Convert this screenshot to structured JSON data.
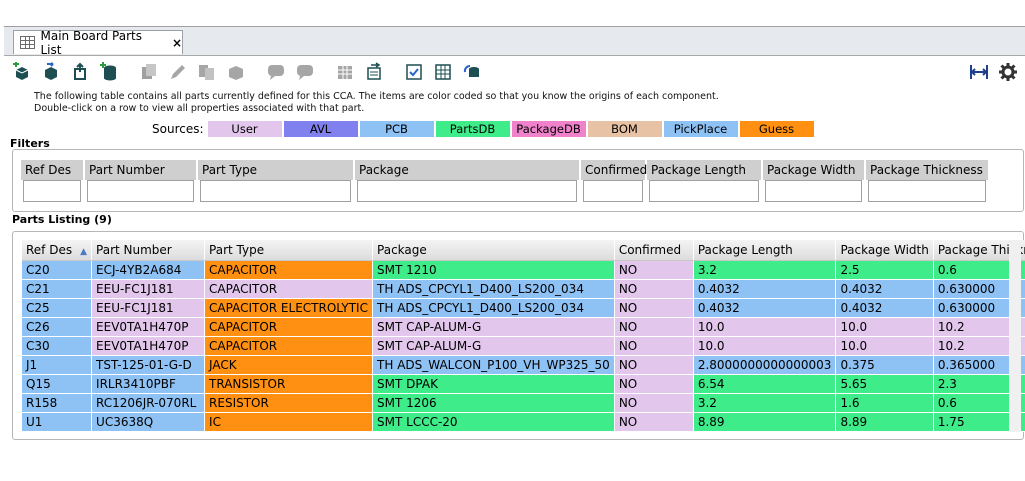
{
  "tab": {
    "title": "Main Board Parts List",
    "close": "×"
  },
  "toolbar": {
    "left_icons": [
      "add-part-icon",
      "import-icon",
      "export-icon",
      "add-database-icon",
      "copy-icon",
      "edit-icon",
      "duplicate-icon",
      "box-icon",
      "comment-icon",
      "comment-icon",
      "grid-import-icon",
      "grid-export-icon",
      "compare-icon",
      "table-icon",
      "sync-icon"
    ],
    "right_icons": [
      "fit-width-icon",
      "gear-icon"
    ]
  },
  "description": {
    "line1": "The following table contains all parts currently defined for this CCA. The items are color coded so that you know the origins of each component.",
    "line2": "Double-click on a row to view all properties associated with that part."
  },
  "sources": {
    "label": "Sources:",
    "items": [
      {
        "name": "User",
        "color": "#e2c6ec"
      },
      {
        "name": "AVL",
        "color": "#8080ef"
      },
      {
        "name": "PCB",
        "color": "#8ec1f4"
      },
      {
        "name": "PartsDB",
        "color": "#3fec8a"
      },
      {
        "name": "PackageDB",
        "color": "#f082cc"
      },
      {
        "name": "BOM",
        "color": "#e8c2a4"
      },
      {
        "name": "PickPlace",
        "color": "#8ec1f4"
      },
      {
        "name": "Guess",
        "color": "#ff9012"
      }
    ]
  },
  "filters": {
    "title": "Filters",
    "columns": [
      "Ref Des",
      "Part Number",
      "Part Type",
      "Package",
      "Confirmed",
      "Package Length",
      "Package Width",
      "Package Thickness"
    ]
  },
  "listing": {
    "title": "Parts Listing (9)",
    "sort_indicator": "▲",
    "columns": [
      "Ref Des",
      "Part Number",
      "Part Type",
      "Package",
      "Confirmed",
      "Package Length",
      "Package Width",
      "Package Thickness"
    ],
    "rows": [
      {
        "cells": [
          "C20",
          "ECJ-4YB2A684",
          "CAPACITOR",
          "SMT 1210",
          "NO",
          "3.2",
          "2.5",
          "0.6"
        ],
        "colors": [
          "#8ec1f4",
          "#8ec1f4",
          "#ff9012",
          "#3fec8a",
          "#e2c6ec",
          "#3fec8a",
          "#3fec8a",
          "#3fec8a"
        ]
      },
      {
        "cells": [
          "C21",
          "EEU-FC1J181",
          "CAPACITOR",
          "TH ADS_CPCYL1_D400_LS200_034",
          "NO",
          "0.4032",
          "0.4032",
          "0.630000"
        ],
        "colors": [
          "#8ec1f4",
          "#e2c6ec",
          "#e2c6ec",
          "#8ec1f4",
          "#e2c6ec",
          "#8ec1f4",
          "#8ec1f4",
          "#8ec1f4"
        ]
      },
      {
        "cells": [
          "C25",
          "EEU-FC1J181",
          "CAPACITOR ELECTROLYTIC",
          "TH ADS_CPCYL1_D400_LS200_034",
          "NO",
          "0.4032",
          "0.4032",
          "0.630000"
        ],
        "colors": [
          "#8ec1f4",
          "#e2c6ec",
          "#ff9012",
          "#8ec1f4",
          "#e2c6ec",
          "#8ec1f4",
          "#8ec1f4",
          "#8ec1f4"
        ]
      },
      {
        "cells": [
          "C26",
          "EEV0TA1H470P",
          "CAPACITOR",
          "SMT CAP-ALUM-G",
          "NO",
          "10.0",
          "10.0",
          "10.2"
        ],
        "colors": [
          "#8ec1f4",
          "#e2c6ec",
          "#ff9012",
          "#e2c6ec",
          "#e2c6ec",
          "#e2c6ec",
          "#e2c6ec",
          "#e2c6ec"
        ]
      },
      {
        "cells": [
          "C30",
          "EEV0TA1H470P",
          "CAPACITOR",
          "SMT CAP-ALUM-G",
          "NO",
          "10.0",
          "10.0",
          "10.2"
        ],
        "colors": [
          "#8ec1f4",
          "#e2c6ec",
          "#ff9012",
          "#e2c6ec",
          "#e2c6ec",
          "#e2c6ec",
          "#e2c6ec",
          "#e2c6ec"
        ]
      },
      {
        "cells": [
          "J1",
          "TST-125-01-G-D",
          "JACK",
          "TH ADS_WALCON_P100_VH_WP325_50",
          "NO",
          "2.8000000000000003",
          "0.375",
          "0.365000"
        ],
        "colors": [
          "#8ec1f4",
          "#8ec1f4",
          "#ff9012",
          "#8ec1f4",
          "#e2c6ec",
          "#8ec1f4",
          "#8ec1f4",
          "#8ec1f4"
        ]
      },
      {
        "cells": [
          "Q15",
          "IRLR3410PBF",
          "TRANSISTOR",
          "SMT DPAK",
          "NO",
          "6.54",
          "5.65",
          "2.3"
        ],
        "colors": [
          "#8ec1f4",
          "#8ec1f4",
          "#ff9012",
          "#3fec8a",
          "#e2c6ec",
          "#3fec8a",
          "#3fec8a",
          "#3fec8a"
        ]
      },
      {
        "cells": [
          "R158",
          "RC1206JR-070RL",
          "RESISTOR",
          "SMT 1206",
          "NO",
          "3.2",
          "1.6",
          "0.6"
        ],
        "colors": [
          "#8ec1f4",
          "#8ec1f4",
          "#ff9012",
          "#3fec8a",
          "#e2c6ec",
          "#3fec8a",
          "#3fec8a",
          "#3fec8a"
        ]
      },
      {
        "cells": [
          "U1",
          "UC3638Q",
          "IC",
          "SMT LCCC-20",
          "NO",
          "8.89",
          "8.89",
          "1.75"
        ],
        "colors": [
          "#8ec1f4",
          "#8ec1f4",
          "#ff9012",
          "#3fec8a",
          "#e2c6ec",
          "#3fec8a",
          "#3fec8a",
          "#3fec8a"
        ]
      }
    ]
  }
}
